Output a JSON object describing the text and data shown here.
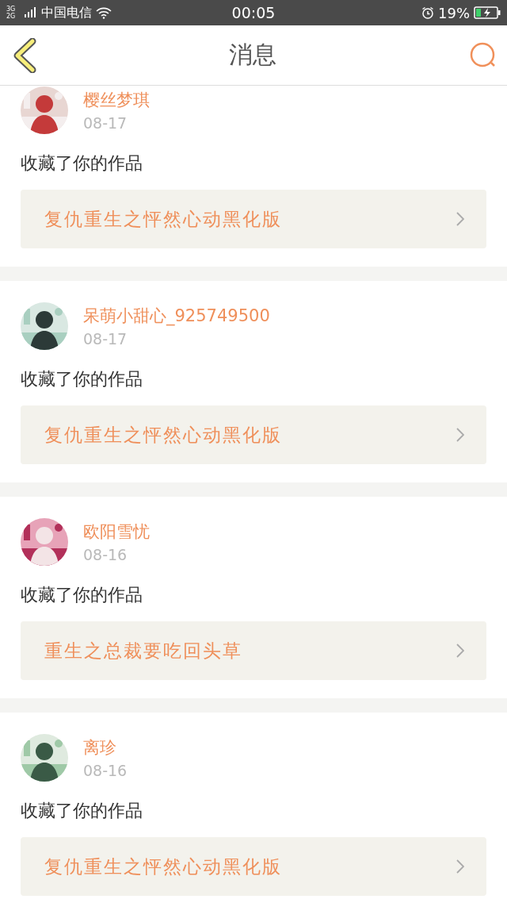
{
  "status_bar": {
    "network": "3G 2G",
    "carrier": "中国电信",
    "time": "00:05",
    "battery": "19%"
  },
  "header": {
    "title": "消息"
  },
  "messages": [
    {
      "user": "樱丝梦琪",
      "date": "08-17",
      "action": "收藏了你的作品",
      "work": "复仇重生之怦然心动黑化版"
    },
    {
      "user": "呆萌小甜心_925749500",
      "date": "08-17",
      "action": "收藏了你的作品",
      "work": "复仇重生之怦然心动黑化版"
    },
    {
      "user": "欧阳雪忧",
      "date": "08-16",
      "action": "收藏了你的作品",
      "work": "重生之总裁要吃回头草"
    },
    {
      "user": "离珍",
      "date": "08-16",
      "action": "收藏了你的作品",
      "work": "复仇重生之怦然心动黑化版"
    }
  ]
}
